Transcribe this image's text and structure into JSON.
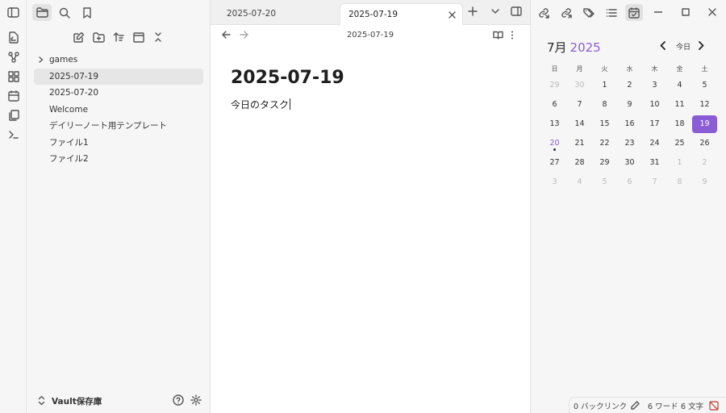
{
  "sidebar": {
    "tree": [
      {
        "label": "games",
        "folder": true
      },
      {
        "label": "2025-07-19",
        "active": true
      },
      {
        "label": "2025-07-20"
      },
      {
        "label": "Welcome"
      },
      {
        "label": "デイリーノート用テンプレート"
      },
      {
        "label": "ファイル1"
      },
      {
        "label": "ファイル2"
      }
    ],
    "vault_name": "Vault保存庫"
  },
  "tabs": {
    "inactive_label": "2025-07-20",
    "active_label": "2025-07-19"
  },
  "editor": {
    "nav_title": "2025-07-19",
    "heading": "2025-07-19",
    "body": "今日のタスク"
  },
  "calendar": {
    "month": "7月",
    "year": "2025",
    "today_button": "今日",
    "weekdays": [
      "日",
      "月",
      "火",
      "水",
      "木",
      "金",
      "土"
    ],
    "weeks": [
      [
        "29",
        "30",
        "1",
        "2",
        "3",
        "4",
        "5"
      ],
      [
        "6",
        "7",
        "8",
        "9",
        "10",
        "11",
        "12"
      ],
      [
        "13",
        "14",
        "15",
        "16",
        "17",
        "18",
        "19"
      ],
      [
        "20",
        "21",
        "22",
        "23",
        "24",
        "25",
        "26"
      ],
      [
        "27",
        "28",
        "29",
        "30",
        "31",
        "1",
        "2"
      ],
      [
        "3",
        "4",
        "5",
        "6",
        "7",
        "8",
        "9"
      ]
    ],
    "selected_day": "19",
    "marked_day": "20",
    "accent_color": "#8a5cd6"
  },
  "status": {
    "backlinks": "0 バックリンク",
    "words": "6 ワード",
    "chars": "6 文字"
  }
}
